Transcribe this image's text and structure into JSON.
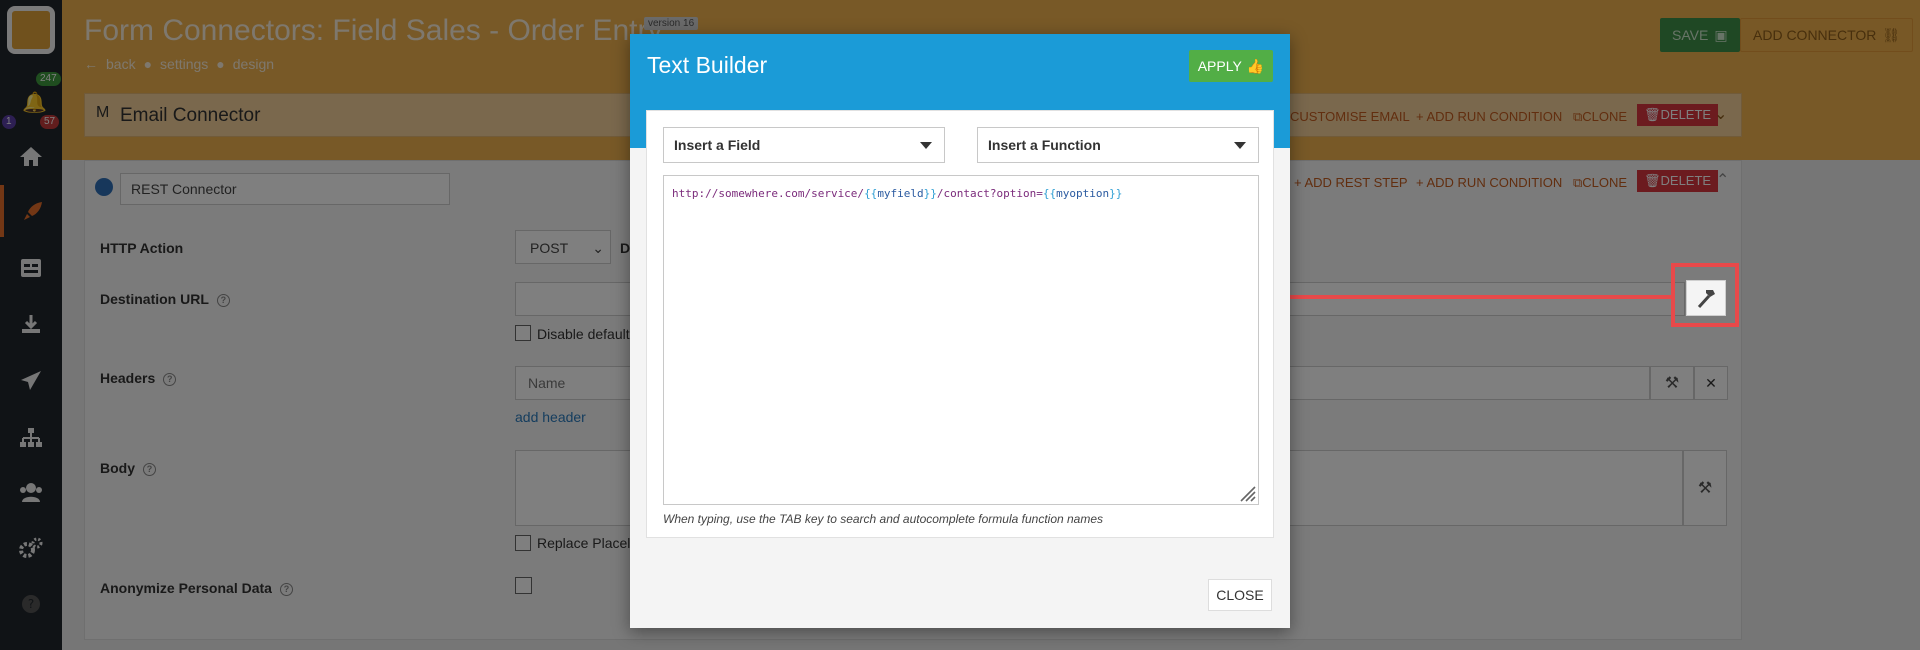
{
  "sidebar": {
    "notification_count": "247",
    "badge_purple": "1",
    "badge_red": "57",
    "items": [
      "home-icon",
      "rocket-icon",
      "forms-icon",
      "download-icon",
      "send-icon",
      "hierarchy-icon",
      "users-icon",
      "gears-icon",
      "help-icon"
    ]
  },
  "header": {
    "title": "Form Connectors: Field Sales - Order Entry",
    "version": "version 16",
    "crumbs": {
      "back": "back",
      "settings": "settings",
      "design": "design"
    },
    "save_label": "SAVE",
    "add_connector_label": "ADD CONNECTOR"
  },
  "email_connector": {
    "title": "Email Connector",
    "customise_email": "CUSTOMISE EMAIL",
    "add_run_condition": "+ ADD RUN CONDITION",
    "clone": "CLONE",
    "delete": "DELETE"
  },
  "rest_connector": {
    "name_value": "REST Connector",
    "add_rest_step": "+ ADD REST STEP",
    "add_run_condition": "+ ADD RUN CONDITION",
    "clone": "CLONE",
    "delete": "DELETE",
    "http_action_label": "HTTP Action",
    "http_action_value": "POST",
    "http_action_trailing": "D",
    "destination_url_label": "Destination URL",
    "disable_default_label": "Disable default",
    "headers_label": "Headers",
    "header_name_placeholder": "Name",
    "add_header": "add header",
    "body_label": "Body",
    "replace_placeholders_label": "Replace Placel",
    "anonymize_label": "Anonymize Personal Data"
  },
  "modal": {
    "title": "Text Builder",
    "apply_label": "APPLY",
    "insert_field_label": "Insert a Field",
    "insert_function_label": "Insert a Function",
    "editor": {
      "p1": "http://somewhere.com/service/",
      "b1": "{{",
      "v1": "myfield",
      "b2": "}}",
      "p2": "/contact?option=",
      "b3": "{{",
      "v2": "myoption",
      "b4": "}}"
    },
    "hint": "When typing, use the TAB key to search and autocomplete formula function names",
    "close_label": "CLOSE"
  },
  "colors": {
    "header": "#f0b24e",
    "modal_header": "#1b9bd7",
    "apply": "#52ae46",
    "annotation": "#e8494a"
  }
}
